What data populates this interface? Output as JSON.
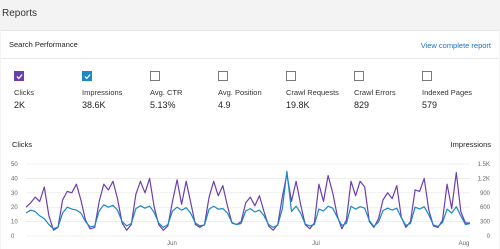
{
  "header": {
    "title": "Reports"
  },
  "card": {
    "title": "Search Performance",
    "view_link": "View complete report"
  },
  "metrics": [
    {
      "label": "Clicks",
      "value": "2K",
      "checked": true,
      "color": "#6c3fb0"
    },
    {
      "label": "Impressions",
      "value": "38.6K",
      "checked": true,
      "color": "#1b88c7"
    },
    {
      "label": "Avg. CTR",
      "value": "5.13%",
      "checked": false
    },
    {
      "label": "Avg. Position",
      "value": "4.9",
      "checked": false
    },
    {
      "label": "Crawl Requests",
      "value": "19.8K",
      "checked": false
    },
    {
      "label": "Crawl Errors",
      "value": "829",
      "checked": false
    },
    {
      "label": "Indexed Pages",
      "value": "579",
      "checked": false
    }
  ],
  "chart_data": {
    "type": "line",
    "left_axis_title": "Clicks",
    "right_axis_title": "Impressions",
    "left_ticks": [
      "0",
      "10",
      "20",
      "30",
      "40",
      "50"
    ],
    "right_ticks": [
      "0",
      "300",
      "600",
      "900",
      "1.2K",
      "1.5K"
    ],
    "ylim_left": [
      0,
      50
    ],
    "ylim_right": [
      0,
      1500
    ],
    "x_labels": [
      "Jun",
      "Jul",
      "Aug"
    ],
    "series": [
      {
        "name": "Clicks",
        "color": "#6c3fb0",
        "axis": "left",
        "values": [
          20,
          23,
          27,
          24,
          34,
          14,
          4,
          6,
          25,
          31,
          30,
          36,
          25,
          11,
          5,
          6,
          24,
          36,
          32,
          38,
          26,
          9,
          4,
          8,
          29,
          38,
          30,
          40,
          20,
          8,
          4,
          7,
          24,
          39,
          22,
          38,
          23,
          8,
          6,
          8,
          27,
          38,
          28,
          35,
          21,
          9,
          8,
          10,
          23,
          27,
          21,
          28,
          17,
          7,
          4,
          8,
          27,
          43,
          24,
          38,
          22,
          8,
          5,
          9,
          36,
          24,
          42,
          30,
          14,
          5,
          11,
          38,
          28,
          38,
          34,
          10,
          6,
          12,
          25,
          30,
          26,
          35,
          13,
          6,
          10,
          32,
          31,
          40,
          18,
          7,
          6,
          11,
          36,
          19,
          44,
          17,
          9,
          9
        ]
      },
      {
        "name": "Impressions",
        "color": "#1b88c7",
        "axis": "right",
        "values": [
          480,
          540,
          510,
          420,
          360,
          240,
          150,
          190,
          480,
          600,
          560,
          540,
          480,
          300,
          190,
          210,
          520,
          650,
          600,
          640,
          540,
          300,
          210,
          260,
          570,
          630,
          580,
          620,
          490,
          270,
          180,
          240,
          520,
          600,
          540,
          590,
          470,
          270,
          210,
          230,
          560,
          620,
          560,
          570,
          480,
          280,
          240,
          260,
          520,
          570,
          500,
          540,
          420,
          240,
          180,
          230,
          560,
          1350,
          510,
          620,
          480,
          250,
          210,
          240,
          560,
          520,
          620,
          580,
          390,
          220,
          260,
          620,
          560,
          610,
          580,
          320,
          200,
          290,
          530,
          580,
          540,
          580,
          380,
          220,
          260,
          600,
          560,
          610,
          440,
          230,
          200,
          280,
          560,
          480,
          610,
          420,
          240,
          260
        ]
      }
    ]
  }
}
